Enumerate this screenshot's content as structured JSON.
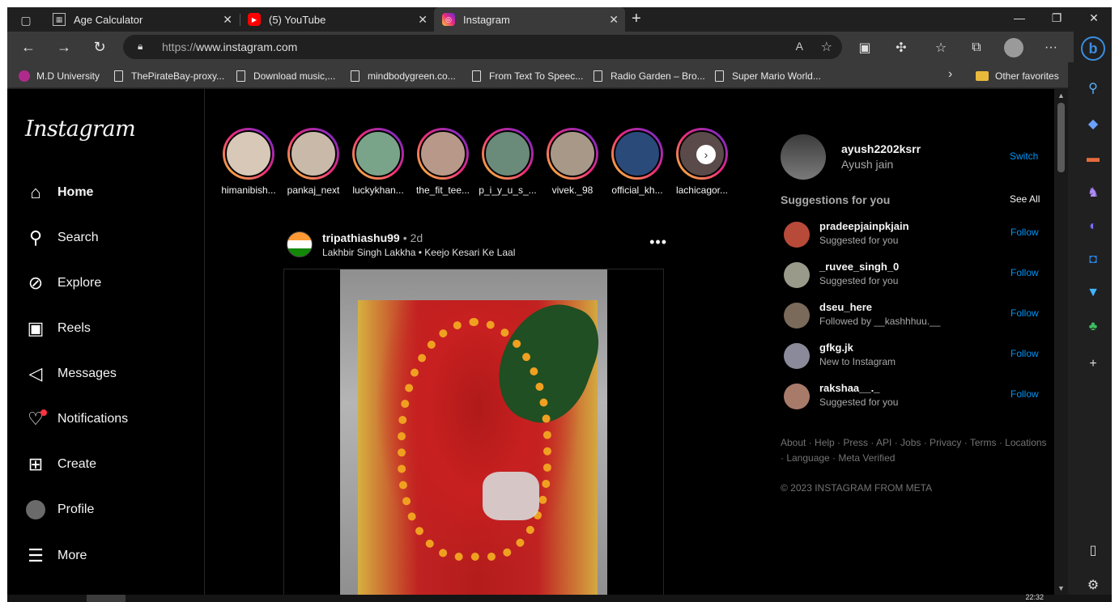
{
  "browser": {
    "tabs": [
      {
        "title": "Age Calculator",
        "favicon": "calculator-icon"
      },
      {
        "title": "(5) YouTube",
        "favicon": "youtube-icon"
      },
      {
        "title": "Instagram",
        "favicon": "instagram-icon"
      }
    ],
    "url_protocol": "https://",
    "url_host": "www.instagram.com",
    "favorites": [
      {
        "label": "M.D University",
        "icon": "university-icon"
      },
      {
        "label": "ThePirateBay-proxy...",
        "icon": "page-icon"
      },
      {
        "label": "Download music,...",
        "icon": "page-icon"
      },
      {
        "label": "mindbodygreen.co...",
        "icon": "page-icon"
      },
      {
        "label": "From Text To Speec...",
        "icon": "page-icon"
      },
      {
        "label": "Radio Garden – Bro...",
        "icon": "page-icon"
      },
      {
        "label": "Super Mario World...",
        "icon": "page-icon"
      }
    ],
    "other_favorites": "Other favorites",
    "time": "22:32"
  },
  "nav": {
    "logo": "Instagram",
    "items": [
      {
        "label": "Home"
      },
      {
        "label": "Search"
      },
      {
        "label": "Explore"
      },
      {
        "label": "Reels"
      },
      {
        "label": "Messages"
      },
      {
        "label": "Notifications"
      },
      {
        "label": "Create"
      },
      {
        "label": "Profile"
      },
      {
        "label": "More"
      }
    ]
  },
  "stories": [
    {
      "name": "himanibish..."
    },
    {
      "name": "pankaj_next"
    },
    {
      "name": "luckykhan..."
    },
    {
      "name": "the_fit_tee..."
    },
    {
      "name": "p_i_y_u_s_..."
    },
    {
      "name": "vivek._98"
    },
    {
      "name": "official_kh..."
    },
    {
      "name": "lachicagor..."
    }
  ],
  "post": {
    "username": "tripathiashu99",
    "separator": "•",
    "age": "2d",
    "audio": "Lakhbir Singh Lakkha • Keejo Kesari Ke Laal"
  },
  "me": {
    "username": "ayush2202ksrr",
    "name": "Ayush jain",
    "switch_label": "Switch"
  },
  "suggestions": {
    "title": "Suggestions for you",
    "see_all": "See All",
    "items": [
      {
        "username": "pradeepjainpkjain",
        "reason": "Suggested for you",
        "action": "Follow"
      },
      {
        "username": "_ruvee_singh_0",
        "reason": "Suggested for you",
        "action": "Follow"
      },
      {
        "username": "dseu_here",
        "reason": "Followed by __kashhhuu.__",
        "action": "Follow"
      },
      {
        "username": "gfkg.jk",
        "reason": "New to Instagram",
        "action": "Follow"
      },
      {
        "username": "rakshaa__._",
        "reason": "Suggested for you",
        "action": "Follow"
      }
    ]
  },
  "footer": {
    "links": "About · Help · Press · API · Jobs · Privacy · Terms · Locations · Language · Meta Verified",
    "copyright": "© 2023 INSTAGRAM FROM META"
  },
  "colors": {
    "accent": "#0095f6",
    "notification_dot": "#ff3040"
  }
}
